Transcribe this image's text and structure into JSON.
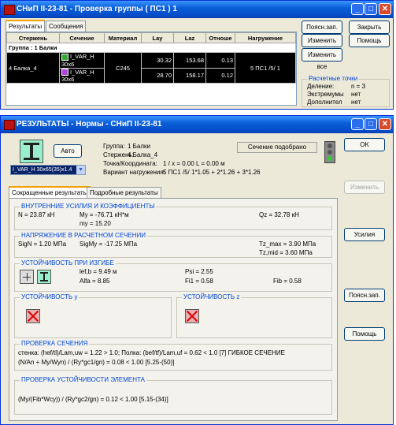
{
  "w1": {
    "title": "СНиП II-23-81 - Проверка группы ( ПС1 ) 1",
    "tabs": [
      "Результаты",
      "Сообщения"
    ],
    "columns": [
      "Стержень",
      "Сечение",
      "Материал",
      "Lay",
      "Laz",
      "Отноше",
      "Нагружение"
    ],
    "group_row": "Группа :  1  Балки",
    "row1": {
      "section": "I_VAR_H 30x6",
      "lay": "30.32",
      "laz": "153.68",
      "ratio": "0.13"
    },
    "row2": {
      "bar": "4  Балка_4",
      "section": "I_VAR_H 30x6",
      "material": "C245",
      "lay": "28.70",
      "laz": "158.17",
      "ratio": "0.12",
      "load": "5 ПС1 /5/ 1"
    },
    "buttons": {
      "explain": "Поясн.зап.",
      "close": "Закрыть",
      "change": "Изменить",
      "help": "Помощь",
      "change_all": "Изменить все"
    },
    "calc_points": {
      "title": "Расчетные точки",
      "division_label": "Деление:",
      "division_value": "n = 3",
      "extremum_label": "Экстремумы",
      "extremum_value": "нет",
      "extra_label": "Дополнител",
      "extra_value": "нет"
    }
  },
  "w2": {
    "title": "РЕЗУЛЬТАТЫ - Нормы - СНиП II-23-81",
    "auto": "Авто",
    "section_select": "I_VAR_H 30x65(35)x1.4",
    "info": {
      "group_label": "Группа:",
      "group_value": "1 Балки",
      "bar_label": "Стержень:",
      "bar_value": "4 Балка_4",
      "point_label": "Точка/Координата:",
      "point_value": "1 / x = 0.00 L = 0.00 м",
      "load_label": "Вариант нагружения:",
      "load_value": "5 ПС1 /5/ 1*1.05 + 2*1.26 + 3*1.26"
    },
    "status": "Сечение подобрано",
    "ok": "OK",
    "change": "Изменить",
    "forces_btn": "Усилия",
    "explain": "Поясн.зап.",
    "help": "Помощь",
    "tabs": [
      "Сокращенные результаты",
      "Подробные результаты"
    ],
    "sections": {
      "forces": {
        "title": "ВНУТРЕННИЕ УСИЛИЯ И КОЭФФИЦИЕНТЫ",
        "n": "N = 23.87 кН",
        "my": "My = -76.71 кН*м",
        "qz": "Qz = 32.78 кН",
        "my2": "my = 15.20"
      },
      "stress": {
        "title": "НАПРЯЖЕНИЕ В РАСЧЕТНОМ СЕЧЕНИИ",
        "sign": "SigN = 1.20 МПа",
        "sigmy": "SigMy = -17.25 МПа",
        "tzmax": "Tz_max = 3.90 МПа",
        "tzmid": "Tz,mid = 3.60 МПа"
      },
      "bending": {
        "title": "УСТОЙЧИВОСТЬ ПРИ ИЗГИБЕ",
        "lef": "lef,b = 9.49 м",
        "alfa": "Alfa = 8.85",
        "psi": "Psi = 2.55",
        "fi1": "Fi1 = 0.58",
        "fib": "Fib = 0.58"
      },
      "stab_y": {
        "title": "УСТОЙЧИВОСТЬ y"
      },
      "stab_z": {
        "title": "УСТОЙЧИВОСТЬ z"
      },
      "check": {
        "title": "ПРОВЕРКА СЕЧЕНИЯ",
        "line1": "стенка: (hef/tl)/Lam,uw = 1.22 > 1.0;    Полка: (bef/tf)/Lam,uf = 0.62 < 1.0  [7]    ГИБКОЕ СЕЧЕНИЕ",
        "line2": "(N/An + My/Wyn) / (Ry*gc1/gn) = 0.08 < 1.00   [5.25-(50)]"
      },
      "element": {
        "title": "ПРОВЕРКА УСТОЙЧИВОСТИ ЭЛЕМЕНТА",
        "line1": "(My/(Fib*Wcy)) / (Ry*gc2/gn) = 0.12 < 1.00   [5.15-(34)]"
      }
    }
  }
}
